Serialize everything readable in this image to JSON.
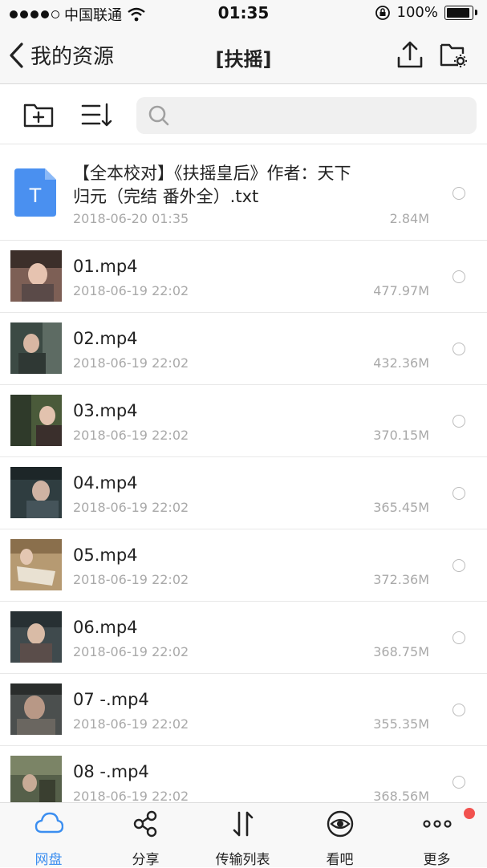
{
  "status": {
    "carrier": "中国联通",
    "time": "01:35",
    "battery": "100%"
  },
  "nav": {
    "back_label": "我的资源",
    "title": "[扶摇]"
  },
  "search": {
    "placeholder": ""
  },
  "files": [
    {
      "name_line1": "【全本校对】《扶摇皇后》作者：天下",
      "name_line2": "归元（完结 番外全）.txt",
      "date": "2018-06-20 01:35",
      "size": "2.84M",
      "type": "text",
      "icon_letter": "T"
    },
    {
      "name": "01.mp4",
      "date": "2018-06-19 22:02",
      "size": "477.97M",
      "type": "video"
    },
    {
      "name": "02.mp4",
      "date": "2018-06-19 22:02",
      "size": "432.36M",
      "type": "video"
    },
    {
      "name": "03.mp4",
      "date": "2018-06-19 22:02",
      "size": "370.15M",
      "type": "video"
    },
    {
      "name": "04.mp4",
      "date": "2018-06-19 22:02",
      "size": "365.45M",
      "type": "video"
    },
    {
      "name": "05.mp4",
      "date": "2018-06-19 22:02",
      "size": "372.36M",
      "type": "video"
    },
    {
      "name": "06.mp4",
      "date": "2018-06-19 22:02",
      "size": "368.75M",
      "type": "video"
    },
    {
      "name": "07 -.mp4",
      "date": "2018-06-19 22:02",
      "size": "355.35M",
      "type": "video"
    },
    {
      "name": "08 -.mp4",
      "date": "2018-06-19 22:02",
      "size": "368.56M",
      "type": "video"
    }
  ],
  "tabs": [
    {
      "label": "网盘",
      "icon": "cloud-icon",
      "active": true
    },
    {
      "label": "分享",
      "icon": "share-icon",
      "active": false
    },
    {
      "label": "传输列表",
      "icon": "transfer-icon",
      "active": false
    },
    {
      "label": "看吧",
      "icon": "eye-icon",
      "active": false
    },
    {
      "label": "更多",
      "icon": "more-icon",
      "active": false
    }
  ],
  "colors": {
    "accent": "#3b8ef0",
    "badge": "#f2524f",
    "txt_icon": "#4a90f0"
  }
}
